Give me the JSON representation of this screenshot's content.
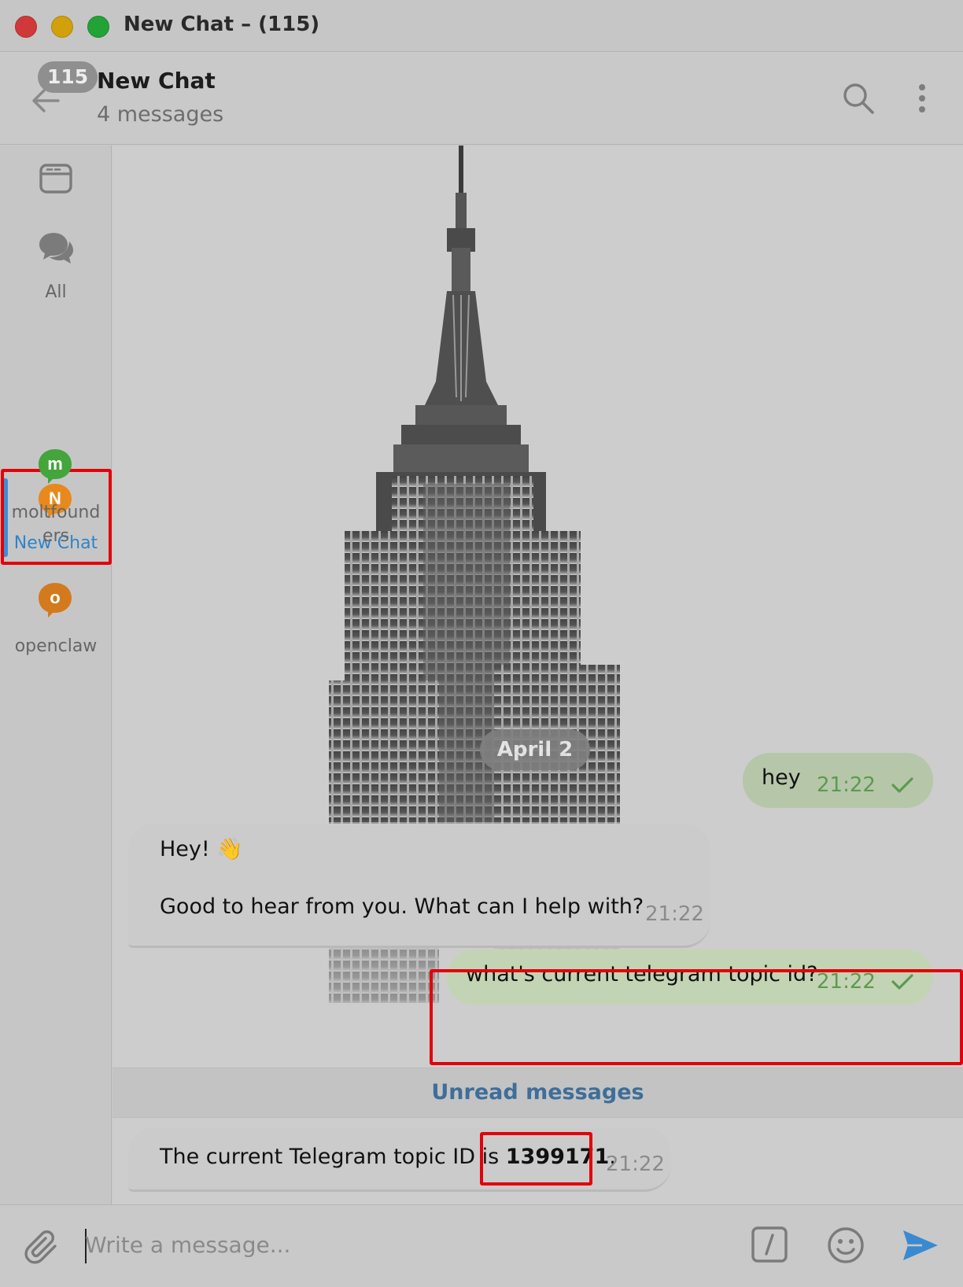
{
  "window": {
    "title": "New Chat – (115)"
  },
  "header": {
    "unread_badge": "115",
    "title": "New Chat",
    "subtitle": "4 messages"
  },
  "sidebar": {
    "items": [
      {
        "label": "",
        "icon": "browser-window-icon"
      },
      {
        "label": "All",
        "icon": "chats-icon"
      },
      {
        "label": "New Chat",
        "letter": "N",
        "color": "#e8891c",
        "active": true
      },
      {
        "label": "moltfound\ners",
        "letter": "m",
        "color": "#43a53b"
      },
      {
        "label": "openclaw",
        "letter": "o",
        "color": "#d47a1e"
      }
    ]
  },
  "chat": {
    "date": "April 2",
    "messages": [
      {
        "direction": "out",
        "text": "hey",
        "time": "21:22",
        "status": "sent"
      },
      {
        "direction": "in",
        "lines": [
          "Hey! 👋",
          "Good to hear from you. What can I help with?"
        ],
        "time": "21:22"
      },
      {
        "direction": "out",
        "text": "what's current telegram topic id?",
        "time": "21:22",
        "status": "sent"
      },
      {
        "direction": "in",
        "prefix": "The current Telegram topic ID is ",
        "highlight": "1399171",
        "suffix": ".",
        "time": "21:22"
      }
    ],
    "unread_divider": "Unread messages"
  },
  "composer": {
    "placeholder": "Write a message..."
  },
  "colors": {
    "accent": "#3c8fd6",
    "outgoing_bubble": "#b6c7a9",
    "highlight_border": "#e3000b",
    "link": "#3e6e99"
  }
}
